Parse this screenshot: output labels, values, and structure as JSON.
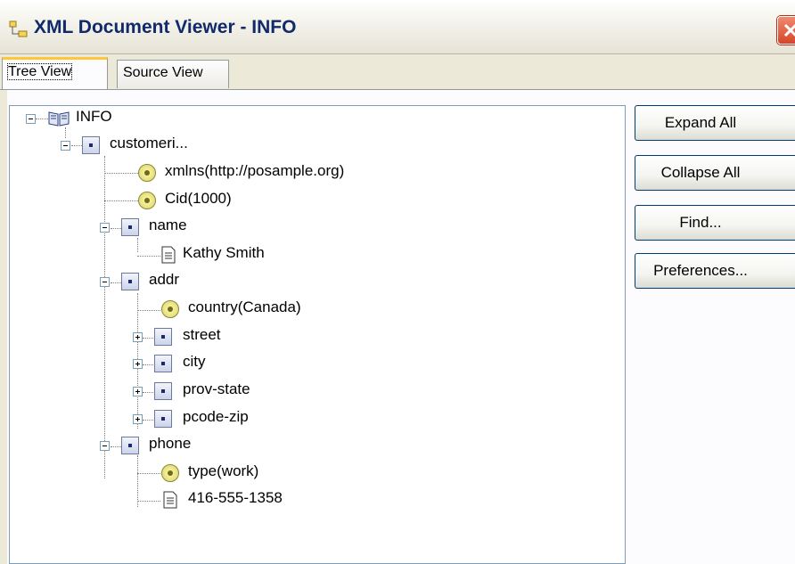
{
  "window": {
    "title": "XML Document Viewer - INFO"
  },
  "tabs": [
    {
      "label": "Tree View",
      "active": true
    },
    {
      "label": "Source View",
      "active": false
    }
  ],
  "tree": {
    "root": "INFO",
    "nodes": [
      {
        "label": "customeri...",
        "type": "element",
        "state": "expanded"
      },
      {
        "label": "xmlns(http://posample.org)",
        "type": "attribute"
      },
      {
        "label": "Cid(1000)",
        "type": "attribute"
      },
      {
        "label": "name",
        "type": "element",
        "state": "expanded"
      },
      {
        "label": "Kathy Smith",
        "type": "text"
      },
      {
        "label": "addr",
        "type": "element",
        "state": "expanded"
      },
      {
        "label": "country(Canada)",
        "type": "attribute"
      },
      {
        "label": "street",
        "type": "element",
        "state": "collapsed"
      },
      {
        "label": "city",
        "type": "element",
        "state": "collapsed"
      },
      {
        "label": "prov-state",
        "type": "element",
        "state": "collapsed"
      },
      {
        "label": "pcode-zip",
        "type": "element",
        "state": "collapsed"
      },
      {
        "label": "phone",
        "type": "element",
        "state": "expanded"
      },
      {
        "label": "type(work)",
        "type": "attribute"
      },
      {
        "label": "416-555-1358",
        "type": "text"
      }
    ]
  },
  "buttons": {
    "expand_all": "Expand All",
    "collapse_all": "Collapse All",
    "find": "Find...",
    "preferences": "Preferences..."
  },
  "colors": {
    "title_text": "#102a6b",
    "tab_highlight": "#ffc83c",
    "button_border": "#003c74",
    "window_bg": "#ece9d8"
  }
}
